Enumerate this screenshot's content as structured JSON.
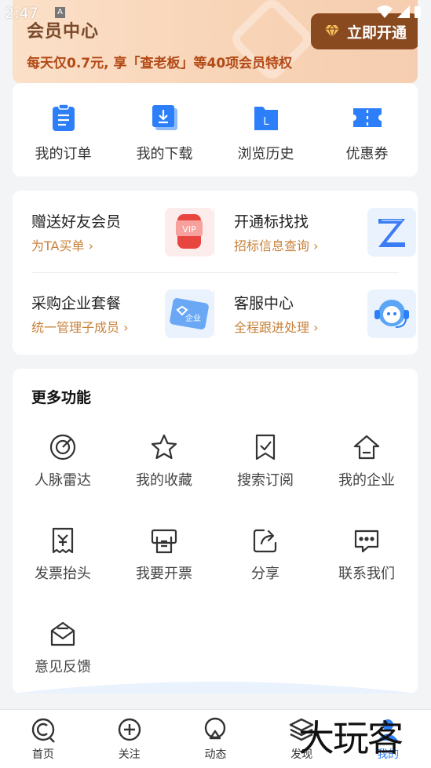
{
  "status_bar": {
    "time": "2:47",
    "notif": "A"
  },
  "vip": {
    "title": "会员中心",
    "subtitle": "每天仅0.7元, 享「查老板」等40项会员特权",
    "button": "立即开通"
  },
  "quick": [
    {
      "label": "我的订单",
      "icon": "clipboard-icon"
    },
    {
      "label": "我的下载",
      "icon": "download-icon"
    },
    {
      "label": "浏览历史",
      "icon": "history-icon"
    },
    {
      "label": "优惠券",
      "icon": "coupon-icon"
    }
  ],
  "promos": [
    {
      "title": "赠送好友会员",
      "sub": "为TA买单",
      "icon": "vip-card-icon"
    },
    {
      "title": "开通标找找",
      "sub": "招标信息查询",
      "icon": "z-logo-icon"
    },
    {
      "title": "采购企业套餐",
      "sub": "统一管理子成员",
      "icon": "enterprise-card-icon"
    },
    {
      "title": "客服中心",
      "sub": "全程跟进处理",
      "icon": "customer-service-icon"
    }
  ],
  "more": {
    "title": "更多功能",
    "items": [
      {
        "label": "人脉雷达",
        "icon": "radar-icon"
      },
      {
        "label": "我的收藏",
        "icon": "star-icon"
      },
      {
        "label": "搜索订阅",
        "icon": "bookmark-check-icon"
      },
      {
        "label": "我的企业",
        "icon": "home-icon"
      },
      {
        "label": "发票抬头",
        "icon": "invoice-icon"
      },
      {
        "label": "我要开票",
        "icon": "printer-icon"
      },
      {
        "label": "分享",
        "icon": "share-icon"
      },
      {
        "label": "联系我们",
        "icon": "chat-icon"
      },
      {
        "label": "意见反馈",
        "icon": "feedback-icon"
      }
    ]
  },
  "tabs": [
    {
      "label": "首页",
      "icon": "home-tab-icon"
    },
    {
      "label": "关注",
      "icon": "add-circle-icon"
    },
    {
      "label": "动态",
      "icon": "activity-icon"
    },
    {
      "label": "发现",
      "icon": "layers-icon"
    },
    {
      "label": "我的",
      "icon": "user-icon",
      "active": true
    }
  ],
  "watermark": "大玩客",
  "colors": {
    "accent": "#2d7ff9",
    "vip_brown": "#8a4a20",
    "promo_orange": "#c8823c"
  }
}
